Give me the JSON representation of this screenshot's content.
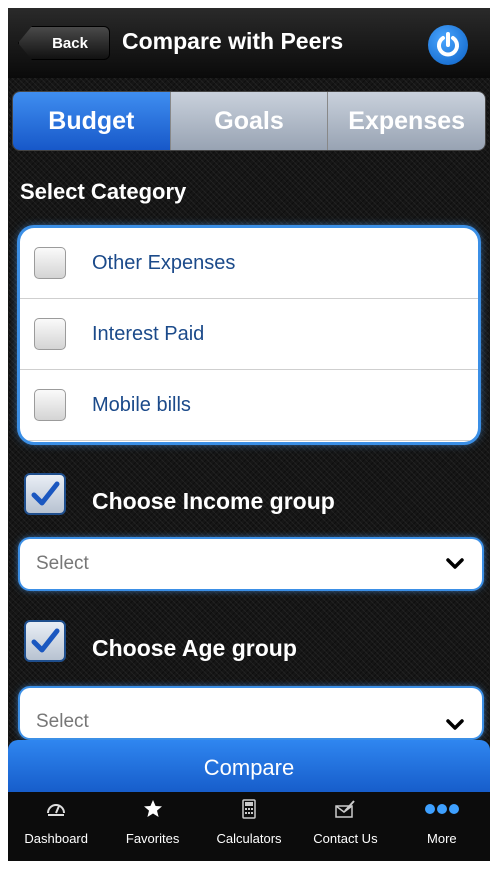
{
  "nav": {
    "back_label": "Back",
    "title": "Compare with Peers",
    "power_icon": "power-icon"
  },
  "segments": [
    {
      "label": "Budget",
      "active": true
    },
    {
      "label": "Goals",
      "active": false
    },
    {
      "label": "Expenses",
      "active": false
    }
  ],
  "section_label": "Select Category",
  "categories": [
    {
      "label": "Other Expenses",
      "checked": false
    },
    {
      "label": "Interest Paid",
      "checked": false
    },
    {
      "label": "Mobile bills",
      "checked": false
    }
  ],
  "income": {
    "label": "Choose Income group",
    "checked": true,
    "select_value": "Select"
  },
  "age": {
    "label": "Choose Age group",
    "checked": true,
    "select_value": "Select"
  },
  "compare_label": "Compare",
  "tabs": [
    {
      "label": "Dashboard",
      "icon": "dashboard-icon"
    },
    {
      "label": "Favorites",
      "icon": "star-icon"
    },
    {
      "label": "Calculators",
      "icon": "calculator-icon"
    },
    {
      "label": "Contact Us",
      "icon": "contact-icon"
    },
    {
      "label": "More",
      "icon": "more-icon"
    }
  ],
  "colors": {
    "accent": "#2f86f0",
    "link_text": "#1b4a8a"
  }
}
